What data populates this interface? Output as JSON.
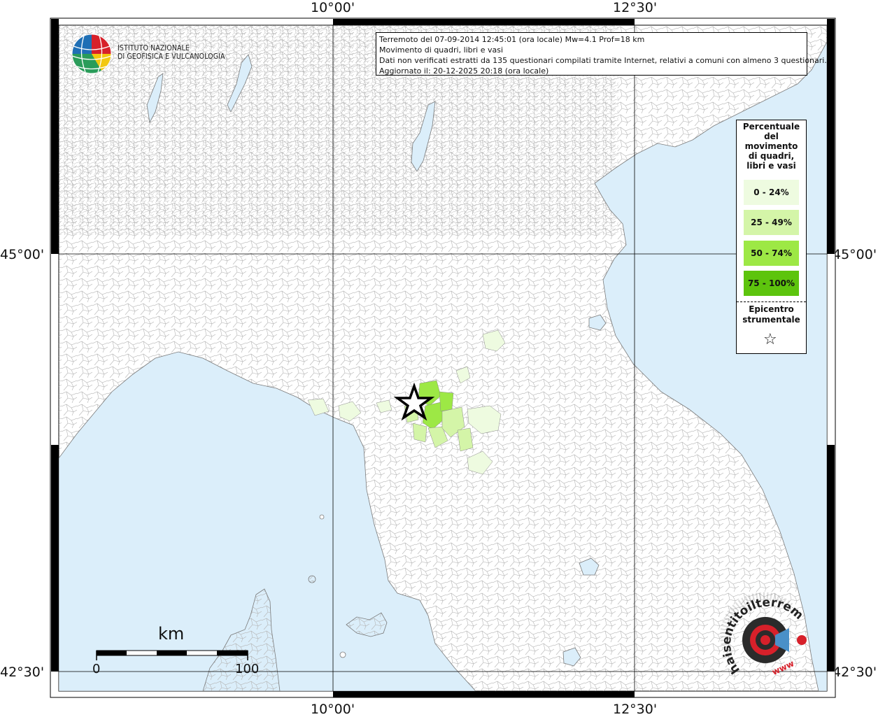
{
  "axis_ticks": {
    "top_lon_1": "10°00'",
    "top_lon_2": "12°30'",
    "bottom_lon_1": "10°00'",
    "bottom_lon_2": "12°30'",
    "left_lat_1": "45°00'",
    "left_lat_2": "42°30'",
    "right_lat_1": "45°00'",
    "right_lat_2": "42°30'"
  },
  "logo": {
    "line1": "ISTITUTO NAZIONALE",
    "line2": "DI GEOFISICA E VULCANOLOGIA"
  },
  "info": {
    "line1": "Terremoto del 07-09-2014 12:45:01 (ora locale) Mw=4.1 Prof=18 km",
    "line2": "Movimento di quadri, libri e vasi",
    "line3": "Dati non verificati estratti da 135 questionari compilati tramite Internet, relativi a comuni con almeno 3 questionari.",
    "line4": "Aggiornato il: 20-12-2025 20:18 (ora locale)"
  },
  "legend": {
    "title_line1": "Percentuale",
    "title_line2": "del",
    "title_line3": "movimento",
    "title_line4": "di quadri,",
    "title_line5": "libri e vasi",
    "classes": [
      {
        "label": "0 - 24%",
        "color": "#eefbe0"
      },
      {
        "label": "25 - 49%",
        "color": "#d4f5a8"
      },
      {
        "label": "50 - 74%",
        "color": "#9de845"
      },
      {
        "label": "75 - 100%",
        "color": "#5dc40d"
      }
    ],
    "epicenter_line1": "Epicentro",
    "epicenter_line2": "strumentale",
    "epicenter_symbol": "☆"
  },
  "scale_bar": {
    "unit": "km",
    "min_label": "0",
    "max_label": "100"
  },
  "colors": {
    "sea": "#dbeefa",
    "land": "#ffffff",
    "borders": "#a9a9a9",
    "grid": "#000000"
  },
  "site_logo": {
    "text": "haisentitoilterremoto.it",
    "url_text": "www"
  }
}
